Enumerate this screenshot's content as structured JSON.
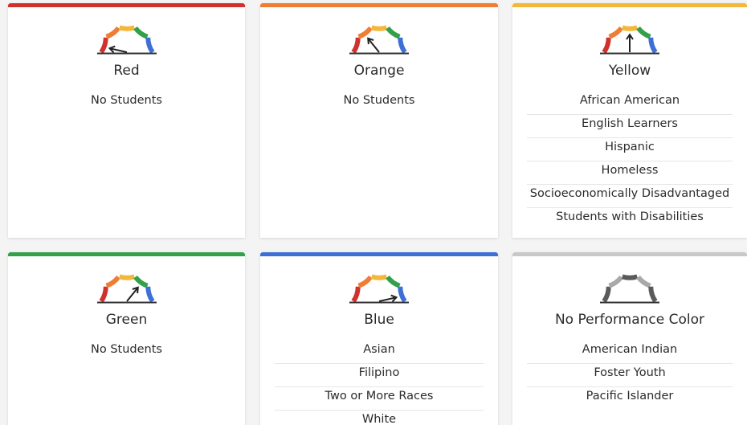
{
  "colors": {
    "red": "#d0312d",
    "orange": "#ef7d33",
    "yellow": "#f3b73a",
    "green": "#33a04a",
    "blue": "#3d6fd6",
    "gray": "#c8c8c8",
    "needle": "#222222"
  },
  "cards": [
    {
      "color_key": "red",
      "gauge_level": 1,
      "title": "Red",
      "groups": [
        "No Students"
      ]
    },
    {
      "color_key": "orange",
      "gauge_level": 2,
      "title": "Orange",
      "groups": [
        "No Students"
      ]
    },
    {
      "color_key": "yellow",
      "gauge_level": 3,
      "title": "Yellow",
      "groups": [
        "African American",
        "English Learners",
        "Hispanic",
        "Homeless",
        "Socioeconomically Disadvantaged",
        "Students with Disabilities"
      ]
    },
    {
      "color_key": "green",
      "gauge_level": 4,
      "title": "Green",
      "groups": [
        "No Students"
      ]
    },
    {
      "color_key": "blue",
      "gauge_level": 5,
      "title": "Blue",
      "groups": [
        "Asian",
        "Filipino",
        "Two or More Races",
        "White"
      ]
    },
    {
      "color_key": "gray",
      "gauge_level": 0,
      "title": "No Performance Color",
      "groups": [
        "American Indian",
        "Foster Youth",
        "Pacific Islander"
      ]
    }
  ]
}
